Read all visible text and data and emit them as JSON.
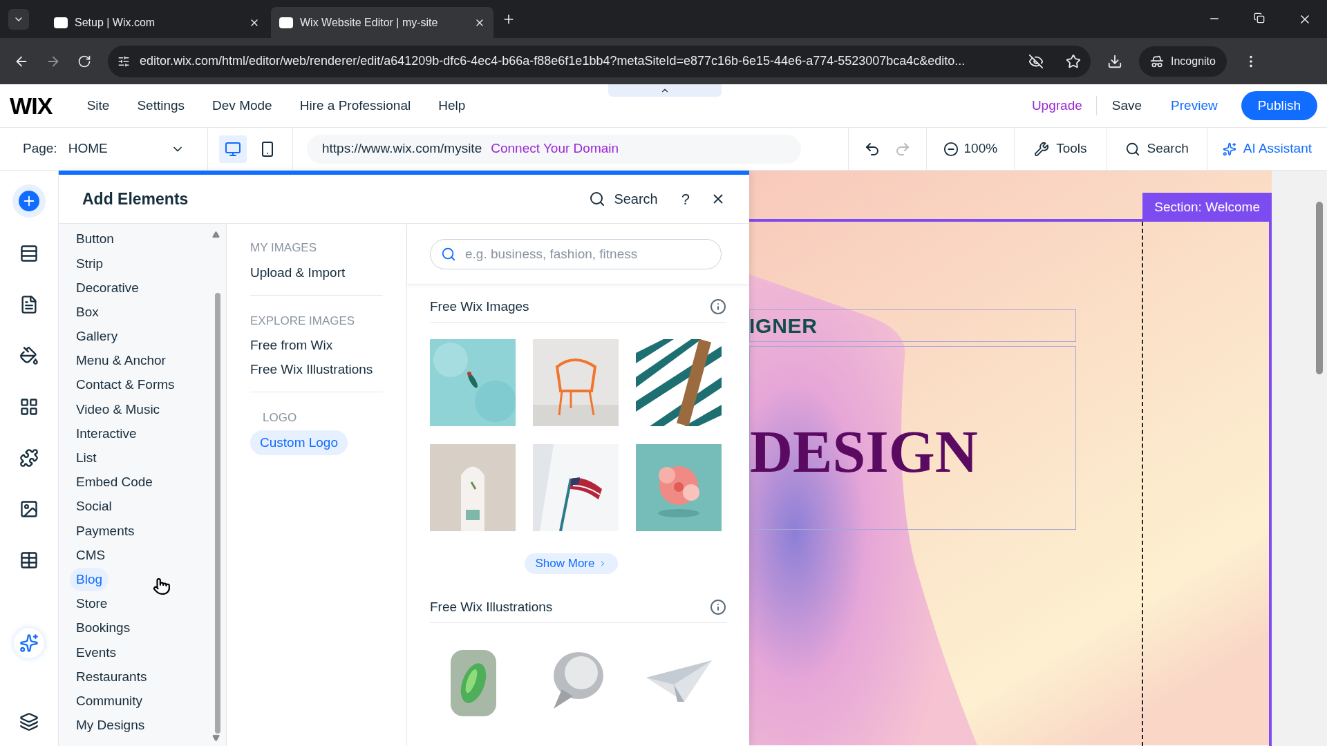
{
  "browser": {
    "tabs": [
      {
        "title": "Setup | Wix.com",
        "selected": false
      },
      {
        "title": "Wix Website Editor | my-site",
        "selected": true
      }
    ],
    "url": "editor.wix.com/html/editor/web/renderer/edit/a641209b-dfc6-4ec4-b66a-f88e6f1e1bb4?metaSiteId=e877c16b-6e15-44e6-a774-5523007bca4c&edito...",
    "profile": "Incognito"
  },
  "editor": {
    "logo": "WIX",
    "menu": [
      "Site",
      "Settings",
      "Dev Mode",
      "Hire a Professional",
      "Help"
    ],
    "upgrade": "Upgrade",
    "save": "Save",
    "preview": "Preview",
    "publish": "Publish"
  },
  "toolbar": {
    "page_label": "Page:",
    "page": "HOME",
    "devices": [
      {
        "kind": "desktop",
        "selected": true
      },
      {
        "kind": "mobile",
        "selected": false
      }
    ],
    "site_url": "https://www.wix.com/mysite",
    "connect_domain": "Connect Your Domain",
    "zoom": "100%",
    "tools": "Tools",
    "search": "Search",
    "ai_assistant": "AI Assistant"
  },
  "rail": [
    {
      "kind": "add",
      "selected": true
    },
    {
      "kind": "sections",
      "selected": false
    },
    {
      "kind": "pages",
      "selected": false
    },
    {
      "kind": "design",
      "selected": false
    },
    {
      "kind": "apps",
      "selected": false
    },
    {
      "kind": "business",
      "selected": false
    },
    {
      "kind": "media",
      "selected": false
    },
    {
      "kind": "cms",
      "selected": false
    },
    {
      "kind": "ai",
      "selected": false
    },
    {
      "kind": "layers",
      "selected": false
    }
  ],
  "panel": {
    "title": "Add Elements",
    "search": "Search",
    "help": "?",
    "categories": [
      {
        "label": "Button",
        "hovered": false
      },
      {
        "label": "Strip",
        "hovered": false
      },
      {
        "label": "Decorative",
        "hovered": false
      },
      {
        "label": "Box",
        "hovered": false
      },
      {
        "label": "Gallery",
        "hovered": false
      },
      {
        "label": "Menu & Anchor",
        "hovered": false
      },
      {
        "label": "Contact & Forms",
        "hovered": false
      },
      {
        "label": "Video & Music",
        "hovered": false
      },
      {
        "label": "Interactive",
        "hovered": false
      },
      {
        "label": "List",
        "hovered": false
      },
      {
        "label": "Embed Code",
        "hovered": false
      },
      {
        "label": "Social",
        "hovered": false
      },
      {
        "label": "Payments",
        "hovered": false
      },
      {
        "label": "CMS",
        "hovered": false
      },
      {
        "label": "Blog",
        "hovered": true
      },
      {
        "label": "Store",
        "hovered": false
      },
      {
        "label": "Bookings",
        "hovered": false
      },
      {
        "label": "Events",
        "hovered": false
      },
      {
        "label": "Restaurants",
        "hovered": false
      },
      {
        "label": "Community",
        "hovered": false
      },
      {
        "label": "My Designs",
        "hovered": false
      }
    ],
    "groups": [
      {
        "heading": "MY IMAGES",
        "items": [
          {
            "label": "Upload & Import",
            "selected": false
          }
        ]
      },
      {
        "heading": "EXPLORE IMAGES",
        "items": [
          {
            "label": "Free from Wix",
            "selected": false
          },
          {
            "label": "Free Wix Illustrations",
            "selected": false
          }
        ]
      },
      {
        "heading": "LOGO",
        "items": [
          {
            "label": "Custom Logo",
            "selected": true
          }
        ]
      }
    ],
    "search_placeholder": "e.g. business, fashion, fitness",
    "images_title": "Free Wix Images",
    "show_more": "Show More",
    "illustrations_title": "Free Wix Illustrations"
  },
  "canvas": {
    "section_label": "Section: Welcome",
    "subtitle": "IGNER",
    "headline": "DESIGN"
  }
}
